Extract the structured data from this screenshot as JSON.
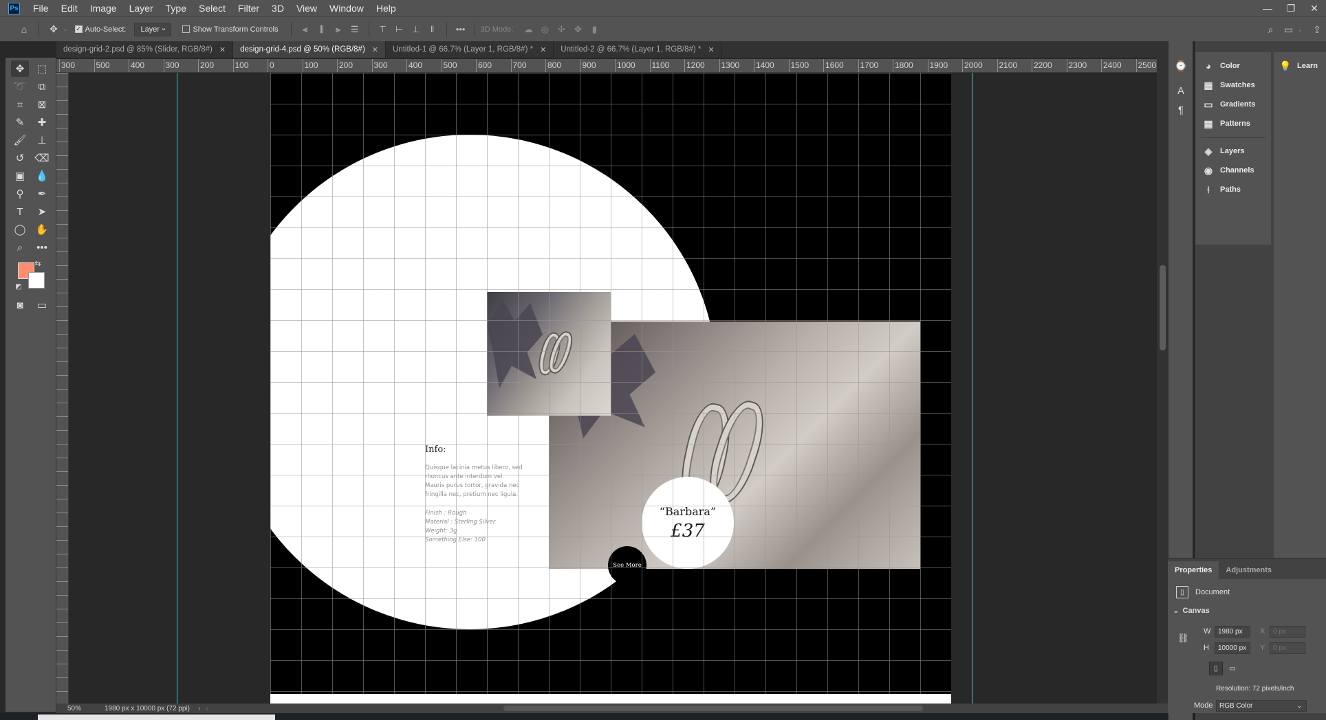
{
  "app": {
    "logo_text": "Ps"
  },
  "menu": [
    "File",
    "Edit",
    "Image",
    "Layer",
    "Type",
    "Select",
    "Filter",
    "3D",
    "View",
    "Window",
    "Help"
  ],
  "window_controls": [
    "—",
    "❐",
    "✕"
  ],
  "options_bar": {
    "auto_select_label": "Auto-Select:",
    "auto_select_checked": true,
    "layer_select_value": "Layer",
    "show_transform_label": "Show Transform Controls",
    "show_transform_checked": false,
    "mode_3d_label": "3D Mode:"
  },
  "tabs": [
    {
      "label": "design-grid-2.psd @ 85% (Slider, RGB/8#)",
      "active": false
    },
    {
      "label": "design-grid-4.psd @ 50% (RGB/8#)",
      "active": true
    },
    {
      "label": "Untitled-1 @ 66.7% (Layer 1, RGB/8#) *",
      "active": false
    },
    {
      "label": "Untitled-2 @ 66.7% (Layer 1, RGB/8#) *",
      "active": false
    }
  ],
  "ruler_top_labels": [
    "300",
    "500",
    "400",
    "300",
    "200",
    "100",
    "0",
    "100",
    "200",
    "300",
    "400",
    "500",
    "600",
    "700",
    "800",
    "900",
    "1000",
    "1100",
    "1200",
    "1300",
    "1400",
    "1500",
    "1600",
    "1700",
    "1800",
    "1900",
    "2000",
    "2100",
    "2200",
    "2300",
    "2400",
    "2500"
  ],
  "document": {
    "info_title": "Info:",
    "info_body": "Quisque lacinia metus libero, sed rhoncus ante interdum vel. Mauris purus tortor, gravida nec fringilla nec, pretium nec ligula.",
    "specs": [
      "Finish : Rough",
      "Material : Sterling Silver",
      "Weight: 3g",
      "Something Else: 100"
    ],
    "product_name": "“Barbara”",
    "product_price": "£37",
    "see_more": "See More"
  },
  "right_panels": {
    "group1": [
      {
        "label": "Color",
        "icon": "color-wheel-icon",
        "glyph": "◕"
      },
      {
        "label": "Swatches",
        "icon": "swatches-grid-icon",
        "glyph": "▦"
      },
      {
        "label": "Gradients",
        "icon": "gradient-icon",
        "glyph": "▭"
      },
      {
        "label": "Patterns",
        "icon": "patterns-icon",
        "glyph": "▦"
      }
    ],
    "group2": [
      {
        "label": "Layers",
        "icon": "layers-icon",
        "glyph": "◈"
      },
      {
        "label": "Channels",
        "icon": "channels-icon",
        "glyph": "◉"
      },
      {
        "label": "Paths",
        "icon": "paths-icon",
        "glyph": "⟊"
      }
    ],
    "learn_label": "Learn"
  },
  "properties": {
    "tab_properties": "Properties",
    "tab_adjustments": "Adjustments",
    "document_label": "Document",
    "canvas_section": "Canvas",
    "w_label": "W",
    "w_value": "1980 px",
    "h_label": "H",
    "h_value": "10000 px",
    "x_label": "X",
    "x_placeholder": "0 px",
    "y_label": "Y",
    "y_placeholder": "0 px",
    "resolution": "Resolution: 72 pixels/inch",
    "mode_label": "Mode",
    "mode_value": "RGB Color"
  },
  "status": {
    "zoom": "50%",
    "doc_size": "1980 px x 10000 px (72 ppi)"
  },
  "colors": {
    "foreground": "#ff8e6e",
    "background": "#ffffff",
    "guide": "#3ec6d6"
  }
}
